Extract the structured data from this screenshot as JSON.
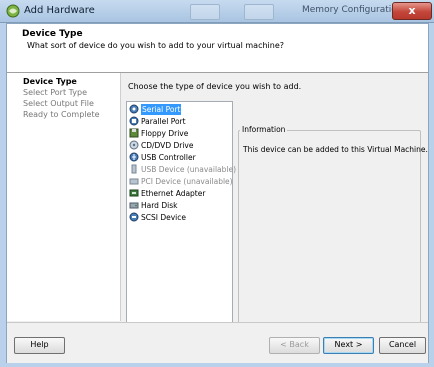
{
  "titlebar": {
    "title": "Add Hardware",
    "background_title": "Memory Configuration",
    "close_glyph": "x"
  },
  "header": {
    "title": "Device Type",
    "subtitle": "What sort of device do you wish to add to your virtual machine?"
  },
  "nav": {
    "items": [
      {
        "label": "Device Type",
        "active": true
      },
      {
        "label": "Select Port Type",
        "active": false
      },
      {
        "label": "Select Output File",
        "active": false
      },
      {
        "label": "Ready to Complete",
        "active": false
      }
    ]
  },
  "content": {
    "prompt": "Choose the type of device you wish to add.",
    "devices": [
      {
        "label": "Serial Port",
        "icon": "serial-port-icon",
        "selected": true,
        "enabled": true
      },
      {
        "label": "Parallel Port",
        "icon": "parallel-port-icon",
        "selected": false,
        "enabled": true
      },
      {
        "label": "Floppy Drive",
        "icon": "floppy-drive-icon",
        "selected": false,
        "enabled": true
      },
      {
        "label": "CD/DVD Drive",
        "icon": "cd-dvd-drive-icon",
        "selected": false,
        "enabled": true
      },
      {
        "label": "USB Controller",
        "icon": "usb-controller-icon",
        "selected": false,
        "enabled": true
      },
      {
        "label": "USB Device (unavailable)",
        "icon": "usb-device-icon",
        "selected": false,
        "enabled": false
      },
      {
        "label": "PCI Device (unavailable)",
        "icon": "pci-device-icon",
        "selected": false,
        "enabled": false
      },
      {
        "label": "Ethernet Adapter",
        "icon": "ethernet-adapter-icon",
        "selected": false,
        "enabled": true
      },
      {
        "label": "Hard Disk",
        "icon": "hard-disk-icon",
        "selected": false,
        "enabled": true
      },
      {
        "label": "SCSI Device",
        "icon": "scsi-device-icon",
        "selected": false,
        "enabled": true
      }
    ],
    "info": {
      "legend": "Information",
      "text": "This device can be added to this Virtual Machine."
    }
  },
  "footer": {
    "help": "Help",
    "back": "< Back",
    "next": "Next >",
    "cancel": "Cancel"
  },
  "colors": {
    "selection": "#3399ff",
    "titlebar": "#b9d1ea",
    "close": "#c4463a"
  }
}
